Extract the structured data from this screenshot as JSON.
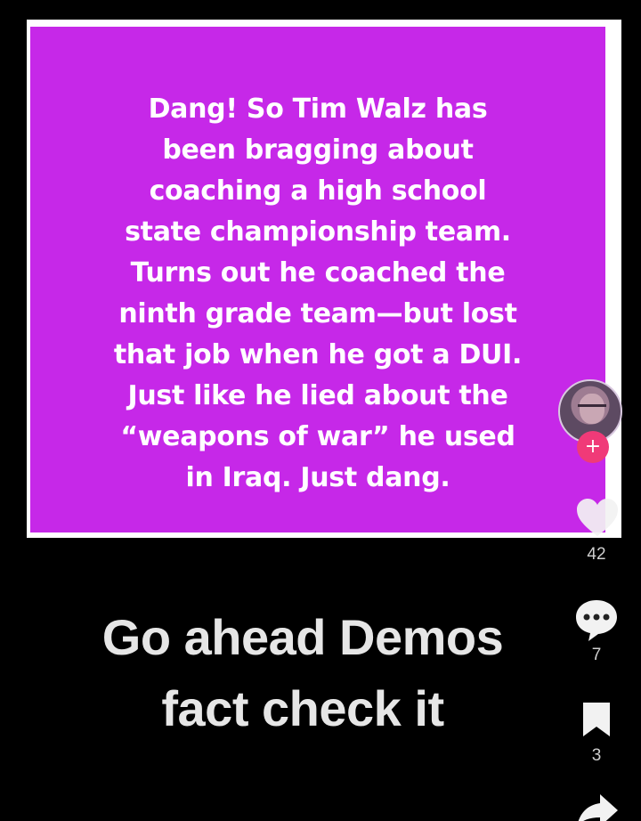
{
  "post": {
    "text": "Dang!  So Tim Walz has\nbeen bragging about\ncoaching a high school\nstate championship team.\nTurns out he coached the\nninth grade team—but lost\nthat job when he got a DUI.\nJust like he lied about the\n“weapons of war” he used\nin Iraq.  Just dang.",
    "background_color": "#c628e8"
  },
  "caption": "Go ahead Demos\nfact check it",
  "actions": {
    "avatar_icon": "profile-avatar",
    "follow_icon": "plus-icon",
    "follow_symbol": "+",
    "like_icon": "heart-icon",
    "like_count": "42",
    "comment_icon": "comment-bubble-icon",
    "comment_count": "7",
    "bookmark_icon": "bookmark-icon",
    "bookmark_count": "3",
    "share_icon": "share-arrow-icon"
  }
}
